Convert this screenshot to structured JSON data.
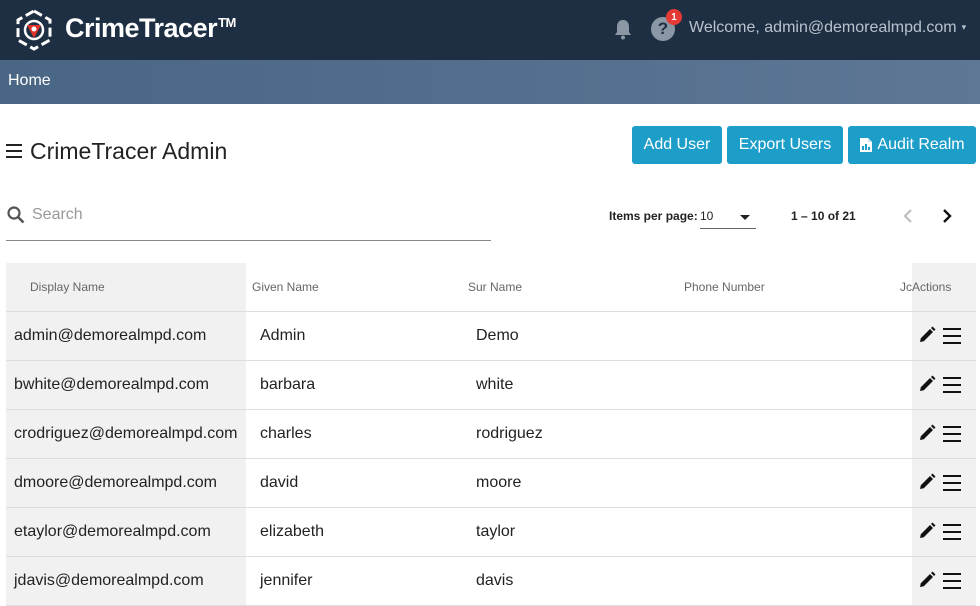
{
  "header": {
    "brand": "CrimeTracer",
    "trademark": "TM",
    "help_symbol": "?",
    "help_badge_count": "1",
    "welcome_text": "Welcome, admin@demorealmpd.com",
    "caret_symbol": "▾",
    "icons": [
      "logo-icon",
      "bell-icon",
      "help-icon",
      "chevron-down-icon"
    ]
  },
  "nav": {
    "home_label": "Home"
  },
  "page": {
    "title": "CrimeTracer Admin"
  },
  "actions": {
    "add_user": "Add User",
    "export_users": "Export Users",
    "audit_realm": "Audit Realm"
  },
  "search": {
    "placeholder": "Search",
    "value": ""
  },
  "paginator": {
    "items_per_page_label": "Items per page:",
    "items_per_page_value": "10",
    "range_label": "1 – 10 of 21"
  },
  "table": {
    "headers": {
      "display_name": "Display Name",
      "given_name": "Given Name",
      "sur_name": "Sur Name",
      "phone_number": "Phone Number",
      "actions": "JcActions"
    },
    "rows": [
      {
        "display_name": "admin@demorealmpd.com",
        "given_name": "Admin",
        "sur_name": "Demo"
      },
      {
        "display_name": "bwhite@demorealmpd.com",
        "given_name": "barbara",
        "sur_name": "white"
      },
      {
        "display_name": "crodriguez@demorealmpd.com",
        "given_name": "charles",
        "sur_name": "rodriguez"
      },
      {
        "display_name": "dmoore@demorealmpd.com",
        "given_name": "david",
        "sur_name": "moore"
      },
      {
        "display_name": "etaylor@demorealmpd.com",
        "given_name": "elizabeth",
        "sur_name": "taylor"
      },
      {
        "display_name": "jdavis@demorealmpd.com",
        "given_name": "jennifer",
        "sur_name": "davis"
      }
    ]
  },
  "colors": {
    "topbar": "#1f2f43",
    "navbar": "#4a6685",
    "button": "#1d9ec9",
    "badge": "#e53935",
    "logo_accent": "#e0322b"
  }
}
